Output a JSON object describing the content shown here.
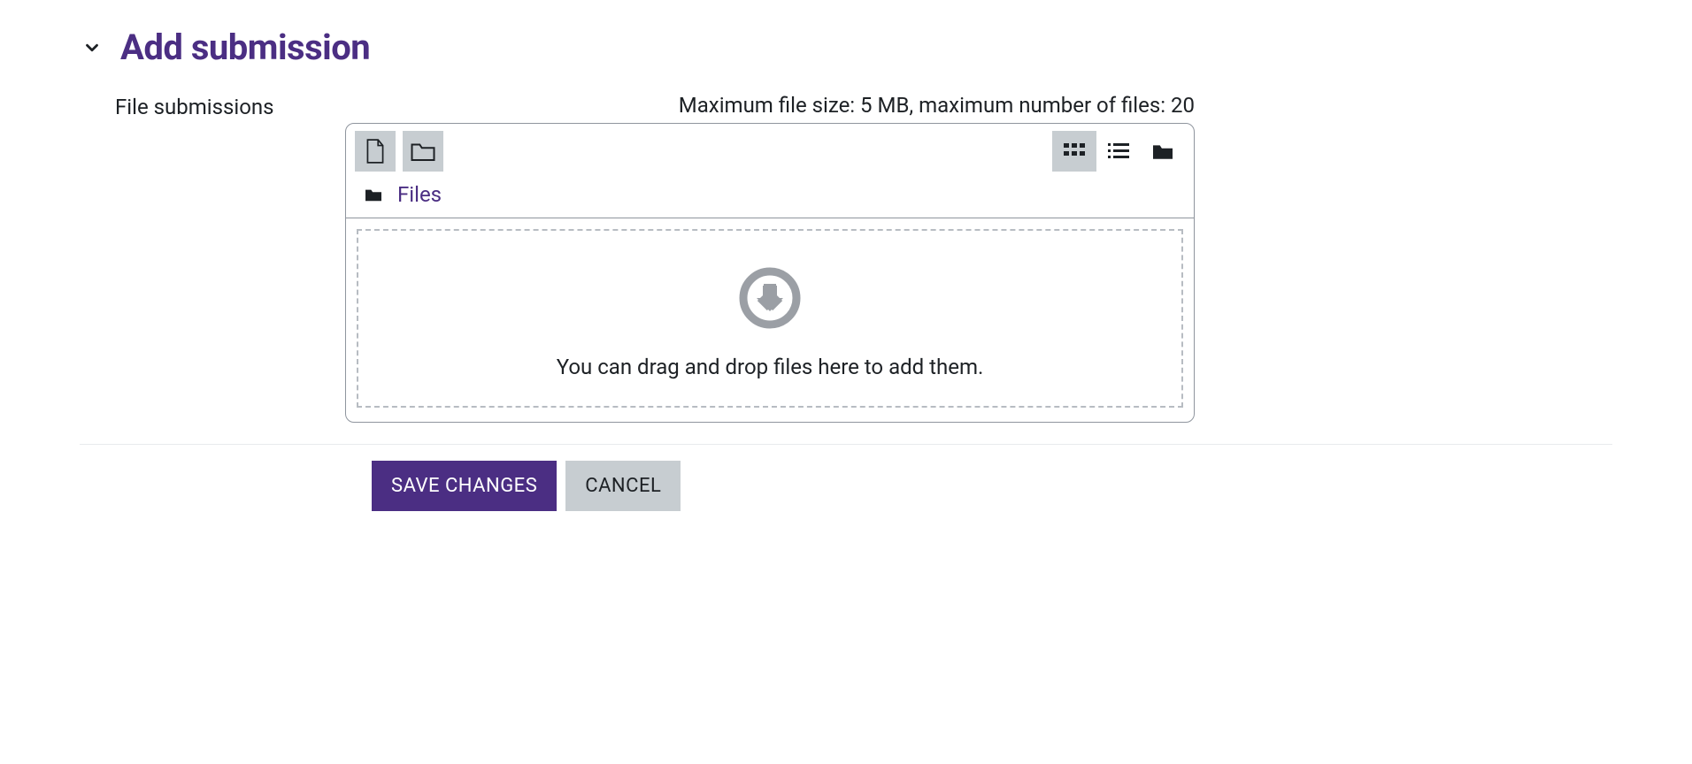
{
  "section": {
    "title": "Add submission"
  },
  "field": {
    "label": "File submissions",
    "limits": "Maximum file size: 5 MB, maximum number of files: 20",
    "breadcrumb_root": "Files",
    "drop_text": "You can drag and drop files here to add them."
  },
  "actions": {
    "save": "SAVE CHANGES",
    "cancel": "CANCEL"
  },
  "colors": {
    "accent": "#4b2e83"
  }
}
